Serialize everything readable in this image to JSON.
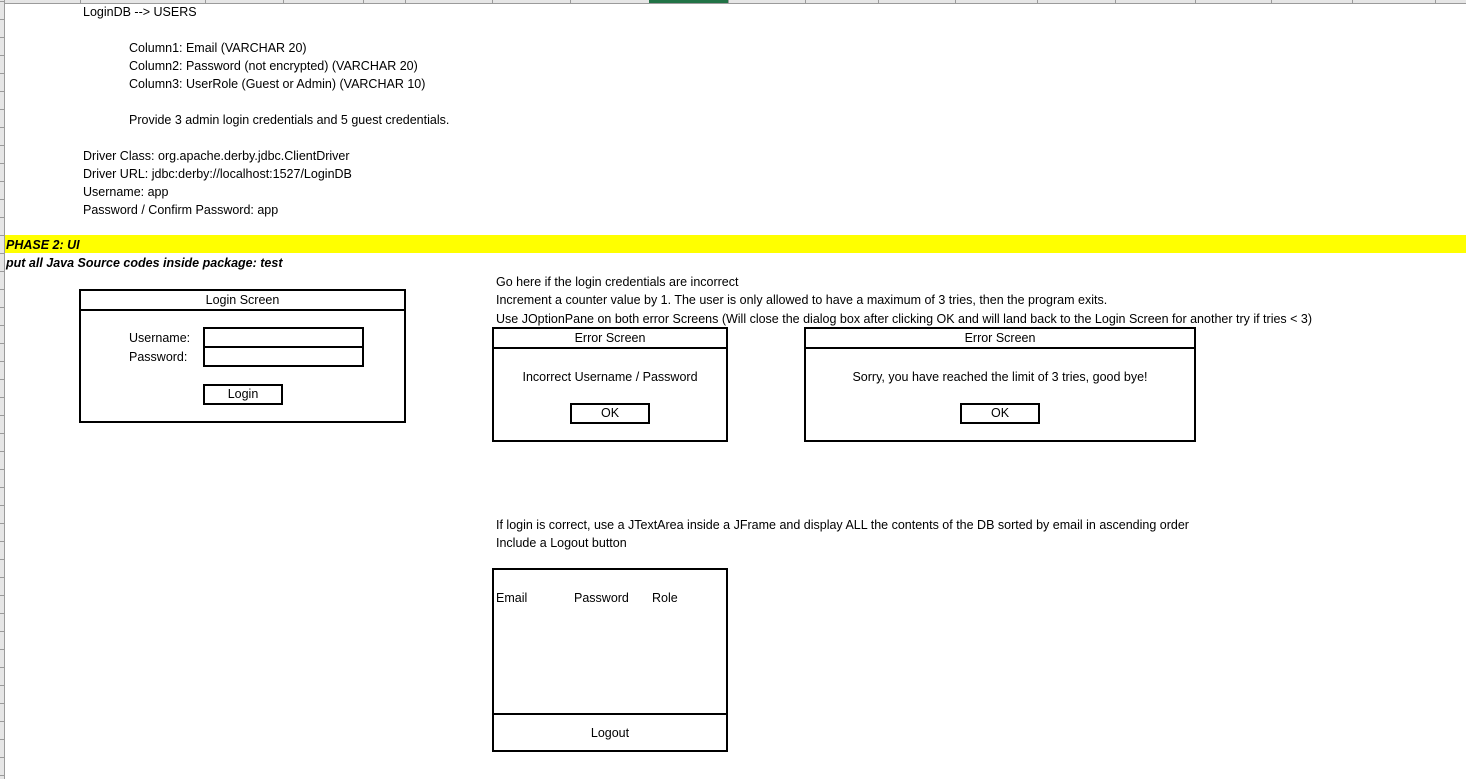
{
  "spreadsheet": {
    "accent_color": "#217346",
    "highlight_color": "#ffff00"
  },
  "db_section": {
    "table_ref": "LoginDB --> USERS",
    "columns": [
      "Column1: Email (VARCHAR 20)",
      "Column2: Password (not encrypted) (VARCHAR 20)",
      "Column3: UserRole (Guest or Admin) (VARCHAR 10)"
    ],
    "credentials_note": "Provide 3 admin login credentials and 5 guest credentials.",
    "connection": [
      "Driver Class: org.apache.derby.jdbc.ClientDriver",
      "Driver URL: jdbc:derby://localhost:1527/LoginDB",
      "Username: app",
      "Password / Confirm Password: app"
    ]
  },
  "phase2": {
    "heading": "PHASE 2: UI",
    "package_note": "put all Java Source codes inside package: test"
  },
  "login_screen": {
    "title": "Login Screen",
    "username_label": "Username:",
    "password_label": "Password:",
    "username_value": "",
    "password_value": "",
    "login_button": "Login"
  },
  "error_notes": [
    "Go here if the login credentials are incorrect",
    "Increment a counter value by 1. The user is only allowed to have a maximum of 3 tries, then the program exits.",
    "Use JOptionPane on both error Screens (Will close the dialog box after clicking OK and will land back to the Login Screen for another try if tries < 3)"
  ],
  "error_screen_1": {
    "title": "Error Screen",
    "message": "Incorrect Username / Password",
    "ok_button": "OK"
  },
  "error_screen_2": {
    "title": "Error Screen",
    "message": "Sorry, you have reached the limit of 3 tries, good bye!",
    "ok_button": "OK"
  },
  "success_notes": [
    "If login is correct, use a JTextArea inside a JFrame and display ALL the contents of the DB sorted by email in ascending order",
    "Include a Logout button"
  ],
  "results_frame": {
    "columns": [
      "Email",
      "Password",
      "Role"
    ],
    "logout_button": "Logout"
  }
}
